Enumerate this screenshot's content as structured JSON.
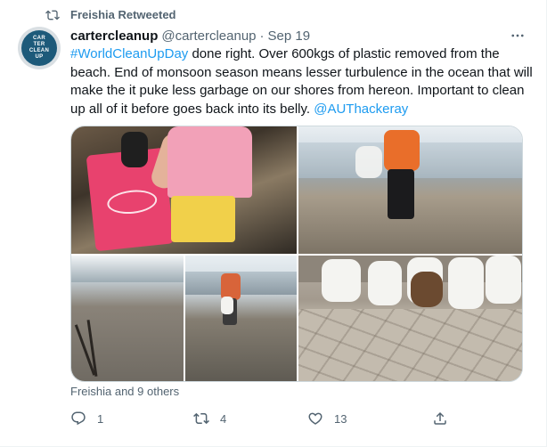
{
  "retweet": {
    "label": "Freishia Retweeted",
    "icon": "retweet-icon"
  },
  "author": {
    "avatar_text": [
      "CAR",
      "TER",
      "CLEAN",
      "UP"
    ],
    "name": "cartercleanup",
    "handle": "@cartercleanup",
    "separator": "·",
    "date": "Sep 19"
  },
  "more_icon": "more-horizontal-icon",
  "tweet": {
    "hashtag": "#WorldCleanUpDay",
    "body_part1": " done right. Over 600kgs of plastic removed from the beach. End of monsoon season means lesser turbulence in the ocean that will make the it puke less garbage on our shores from hereon. Important to clean up all of it before goes back into its belly. ",
    "mention": "@AUThackeray"
  },
  "media": {
    "images": [
      {
        "description": "child holding pink plastic container on rocky beach"
      },
      {
        "description": "person in orange top collecting garbage on beach"
      },
      {
        "description": "sandy beach with sticks"
      },
      {
        "description": "person picking up waste near shoreline"
      },
      {
        "description": "sacks of collected garbage on paved path"
      }
    ]
  },
  "social_context": "Freishia and 9 others",
  "actions": {
    "reply": {
      "icon": "reply-icon",
      "count": "1"
    },
    "retweet": {
      "icon": "retweet-icon",
      "count": "4"
    },
    "like": {
      "icon": "heart-icon",
      "count": "13"
    },
    "share": {
      "icon": "share-icon",
      "count": ""
    }
  },
  "colors": {
    "link": "#1d9bf0",
    "secondary_text": "#536471",
    "primary_text": "#0f1419"
  }
}
